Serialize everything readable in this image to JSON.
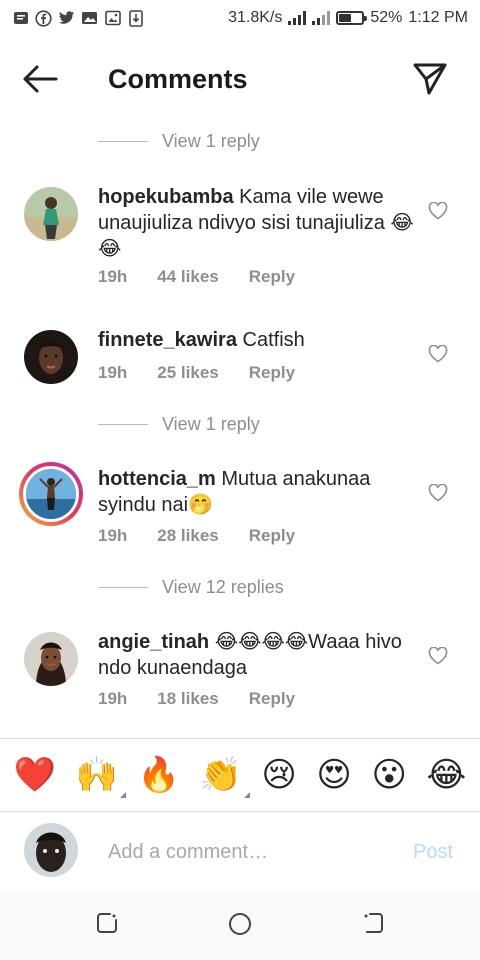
{
  "status_bar": {
    "net_speed": "31.8K/s",
    "battery_percent": "52%",
    "battery_level": 0.52,
    "time": "1:12 PM",
    "left_icons": [
      "message-icon",
      "facebook-icon",
      "twitter-icon",
      "gallery-icon",
      "image-icon",
      "download-icon"
    ]
  },
  "header": {
    "title": "Comments"
  },
  "view_replies": [
    {
      "label": "View 1 reply"
    },
    {
      "label": "View 1 reply"
    },
    {
      "label": "View 12 replies"
    }
  ],
  "comments": [
    {
      "username": "hopekubamba",
      "text": "Kama vile wewe unaujiuliza ndivyo sisi tunajiuliza 😂😂",
      "time": "19h",
      "likes": "44 likes",
      "reply": "Reply"
    },
    {
      "username": "finnete_kawira",
      "text": "Catfish",
      "time": "19h",
      "likes": "25 likes",
      "reply": "Reply"
    },
    {
      "username": "hottencia_m",
      "text": "Mutua anakunaa syindu nai🤭",
      "time": "19h",
      "likes": "28 likes",
      "reply": "Reply"
    },
    {
      "username": "angie_tinah",
      "text": "😂😂😂😂Waaa hivo ndo kunaendaga",
      "time": "19h",
      "likes": "18 likes",
      "reply": "Reply"
    }
  ],
  "emoji_bar": [
    "❤️",
    "🙌",
    "🔥",
    "👏",
    "😢",
    "😍",
    "😮",
    "😂"
  ],
  "add_comment": {
    "placeholder": "Add a comment…",
    "post_label": "Post"
  },
  "colors": {
    "text": "#262626",
    "secondary": "#8e8e8e",
    "post_disabled": "#b3dbff",
    "divider": "#dbdbdb"
  }
}
